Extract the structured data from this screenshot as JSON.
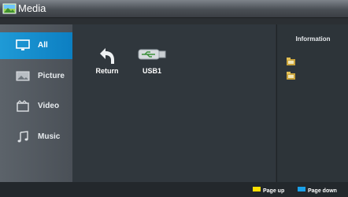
{
  "app": {
    "title": "Media"
  },
  "sidebar": {
    "items": [
      {
        "label": "All",
        "icon": "monitor-icon"
      },
      {
        "label": "Picture",
        "icon": "picture-icon"
      },
      {
        "label": "Video",
        "icon": "video-icon"
      },
      {
        "label": "Music",
        "icon": "music-icon"
      }
    ]
  },
  "main": {
    "tiles": [
      {
        "label": "Return",
        "icon": "return-arrow-icon"
      },
      {
        "label": "USB1",
        "icon": "usb-drive-icon"
      }
    ]
  },
  "info": {
    "title": "Information"
  },
  "footer": {
    "page_up": {
      "label": "Page up",
      "color": "#ffe000"
    },
    "page_down": {
      "label": "Page down",
      "color": "#1aa0e8"
    }
  },
  "colors": {
    "accent": "#0f87c9",
    "background": "#30373d"
  }
}
